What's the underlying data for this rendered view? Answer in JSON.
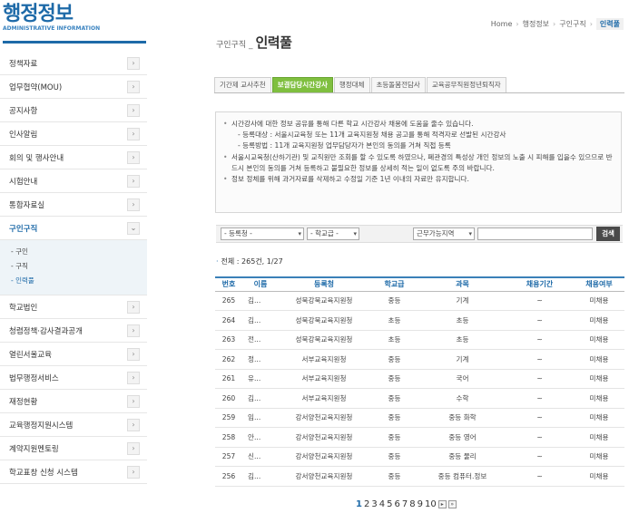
{
  "brand": {
    "title": "행정정보",
    "subtitle": "ADMINISTRATIVE INFORMATION"
  },
  "sidebar": {
    "items": [
      {
        "label": "정책자료",
        "arrow": "›"
      },
      {
        "label": "업무협약(MOU)",
        "arrow": "›"
      },
      {
        "label": "공지사항",
        "arrow": "›"
      },
      {
        "label": "인사알림",
        "arrow": "›"
      },
      {
        "label": "회의 및 행사안내",
        "arrow": "›"
      },
      {
        "label": "시험안내",
        "arrow": "›"
      },
      {
        "label": "통합자료실",
        "arrow": "›"
      },
      {
        "label": "구인구직",
        "arrow": "⌄",
        "active": true
      },
      {
        "label": "학교법인",
        "arrow": "›"
      },
      {
        "label": "청렴정책·감사결과공개",
        "arrow": "›"
      },
      {
        "label": "열린서울교육",
        "arrow": "›"
      },
      {
        "label": "법무행정서비스",
        "arrow": "›"
      },
      {
        "label": "재정현황",
        "arrow": "›"
      },
      {
        "label": "교육행정지원시스템",
        "arrow": "›"
      },
      {
        "label": "계약지원멘토링",
        "arrow": "›"
      },
      {
        "label": "학교표창 신청 시스템",
        "arrow": "›"
      }
    ],
    "submenu": [
      {
        "label": "- 구인"
      },
      {
        "label": "- 구직"
      },
      {
        "label": "- 인력풀",
        "active": true
      }
    ]
  },
  "breadcrumb": [
    "Home",
    "행정정보",
    "구인구직",
    "인력풀"
  ],
  "page": {
    "pre": "구인구직 _",
    "title": "인력풀"
  },
  "tabs": [
    {
      "label": "기간제 교사추천"
    },
    {
      "label": "보결담당시간강사",
      "active": true
    },
    {
      "label": "행정대체"
    },
    {
      "label": "초등돌봄전담사"
    },
    {
      "label": "교육공무직원정년퇴직자"
    }
  ],
  "notice": {
    "b1": "시간강사에 대한 정보 공유를 통해 다른 학교 시간강사 채용에 도움을 줄수 있습니다.",
    "b1_sub1": "- 등록대상 : 서울시교육청 또는 11개 교육지원청 채용 공고를 통해 적격자로 선발된 시간강사",
    "b1_sub2": "- 등록방법 : 11개 교육지원청 업무담당자가 본인의 동의를 거쳐 직접 등록",
    "b2": "서울시교육청(산하기관) 및 교직원만 조회를 할 수 있도록 하였으나, 폐관경의 특성상 개인 정보의 노출 시 피해를 입을수 있으므로 반드시 본인의 동의를 거쳐 등록하고 불필요한 정보를 상세히 적는 일이 없도록 주의 바랍니다.",
    "b3": "정보 정체를 위해 과거자료를 삭제하고 수정일 기준 1년 이내의 자료만 유지합니다."
  },
  "search": {
    "org_select": "- 등록청 -",
    "level_select": "- 학교급 -",
    "area_select": "근무가능지역",
    "keyword_value": "",
    "button": "검색"
  },
  "total_text": "전체 : 265건, 1/27",
  "table": {
    "headers": [
      "번호",
      "이름",
      "등록청",
      "학교급",
      "과목",
      "채용기간",
      "채용여부"
    ],
    "rows": [
      [
        "265",
        "김...",
        "성북강북교육지원청",
        "중등",
        "기계",
        "~",
        "미채용"
      ],
      [
        "264",
        "김...",
        "성북강북교육지원청",
        "초등",
        "초등",
        "~",
        "미채용"
      ],
      [
        "263",
        "전...",
        "성북강북교육지원청",
        "초등",
        "초등",
        "~",
        "미채용"
      ],
      [
        "262",
        "정...",
        "서부교육지원청",
        "중등",
        "기계",
        "~",
        "미채용"
      ],
      [
        "261",
        "유...",
        "서부교육지원청",
        "중등",
        "국어",
        "~",
        "미채용"
      ],
      [
        "260",
        "김...",
        "서부교육지원청",
        "중등",
        "수학",
        "~",
        "미채용"
      ],
      [
        "259",
        "임...",
        "강서양천교육지원청",
        "중등",
        "중등 화학",
        "~",
        "미채용"
      ],
      [
        "258",
        "안...",
        "강서양천교육지원청",
        "중등",
        "중등 영어",
        "~",
        "미채용"
      ],
      [
        "257",
        "신...",
        "강서양천교육지원청",
        "중등",
        "중등 물리",
        "~",
        "미채용"
      ],
      [
        "256",
        "김...",
        "강서양천교육지원청",
        "중등",
        "중등 컴퓨터.정보",
        "~",
        "미채용"
      ]
    ]
  },
  "pager": {
    "pages": [
      "1",
      "2",
      "3",
      "4",
      "5",
      "6",
      "7",
      "8",
      "9",
      "10"
    ],
    "current": "1",
    "next": "▸",
    "last": "»"
  }
}
